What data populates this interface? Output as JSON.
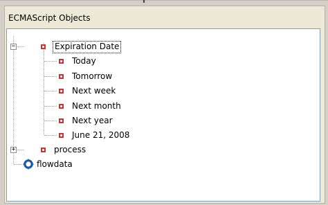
{
  "panel": {
    "title": "ECMAScript Objects"
  },
  "tree": {
    "expiration": {
      "label": "Expiration Date",
      "expander": "−",
      "children": [
        "Today",
        "Tomorrow",
        "Next week",
        "Next month",
        "Next year",
        "June 21, 2008"
      ]
    },
    "process": {
      "label": "process",
      "expander": "+"
    },
    "flowdata": {
      "label": "flowdata",
      "icon": "flowdata-icon"
    }
  },
  "colors": {
    "node_icon": "#d23030",
    "flow_icon": "#1c5aa8",
    "tree_border": "#7f9db9",
    "panel_bg": "#ece9d8"
  }
}
